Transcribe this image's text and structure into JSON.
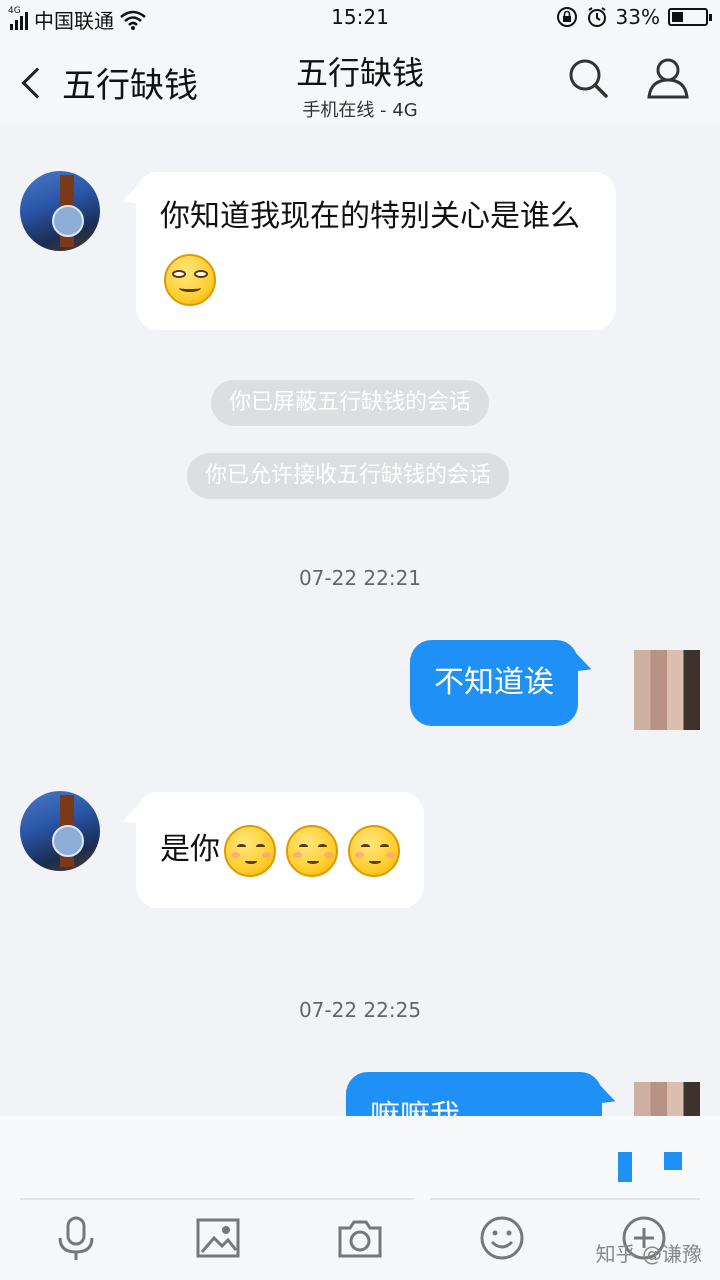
{
  "status_bar": {
    "network_tag": "4G",
    "carrier": "中国联通",
    "time": "15:21",
    "battery": "33%",
    "battery_level": 0.33
  },
  "header": {
    "back_label": "五行缺钱",
    "contact_name": "五行缺钱",
    "contact_status": "手机在线 - 4G",
    "search_icon": "search-icon",
    "profile_icon": "profile-icon"
  },
  "messages": [
    {
      "direction": "in",
      "text": "你知道我现在的特别关心是谁么",
      "emoji": "smirk-emoji"
    },
    {
      "type": "notice",
      "text": "你已屏蔽五行缺钱的会话"
    },
    {
      "type": "notice",
      "text": "你已允许接收五行缺钱的会话"
    },
    {
      "type": "timestamp",
      "text": "07-22 22:21"
    },
    {
      "direction": "out",
      "text": "不知道诶"
    },
    {
      "direction": "in",
      "text": "是你",
      "emoji": "blush-emoji"
    },
    {
      "type": "timestamp",
      "text": "07-22 22:25"
    },
    {
      "direction": "out",
      "text": "嘛嘛我"
    }
  ],
  "toolbar": {
    "items": [
      "microphone-icon",
      "image-icon",
      "camera-icon",
      "emoji-icon",
      "add-icon"
    ]
  },
  "watermark": "知乎 @谦豫",
  "colors": {
    "outgoing_bubble": "#1e90f6",
    "incoming_bubble": "#ffffff",
    "background": "#f1f3f6",
    "notice_pill": "#dcdee2"
  }
}
